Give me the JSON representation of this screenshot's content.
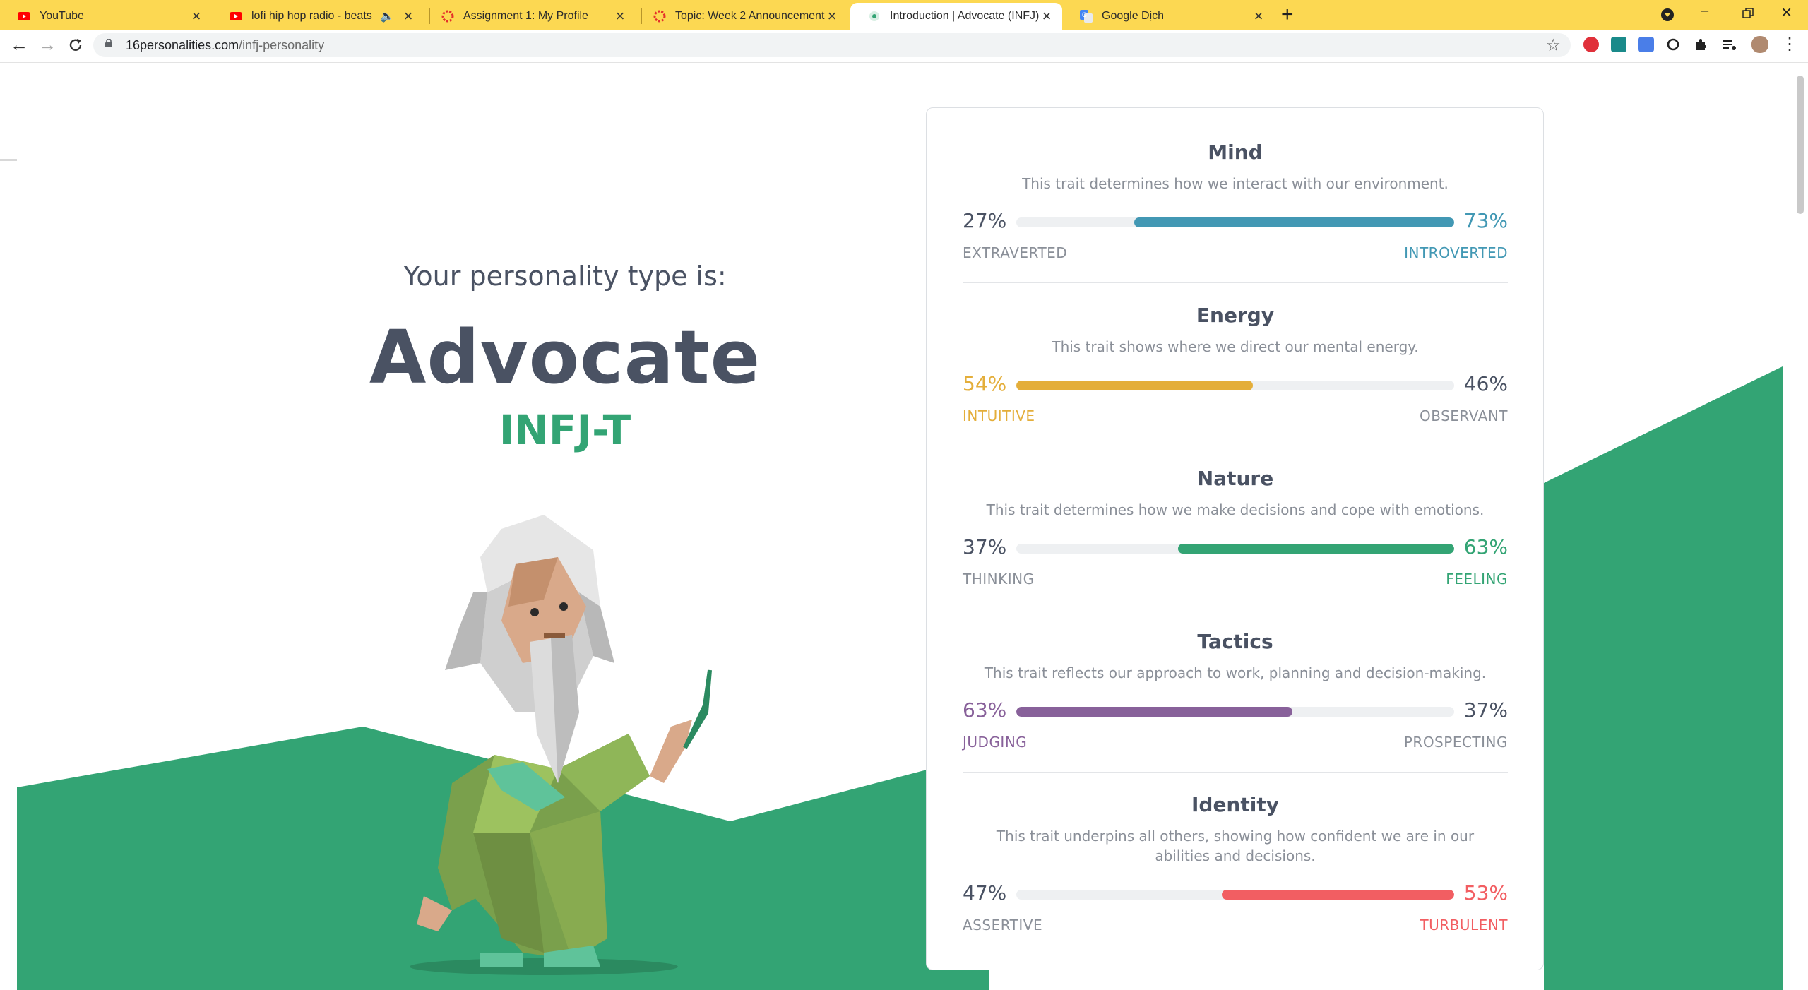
{
  "browser": {
    "tabs": [
      {
        "title": "YouTube",
        "active": false
      },
      {
        "title": "lofi hip hop radio - beats to r",
        "active": false
      },
      {
        "title": "Assignment 1: My Profile",
        "active": false
      },
      {
        "title": "Topic: Week 2 Announcement",
        "active": false
      },
      {
        "title": "Introduction | Advocate (INFJ) Pe",
        "active": true
      },
      {
        "title": "Google Dịch",
        "active": false
      }
    ],
    "url_host": "16personalities.com",
    "url_path": "/infj-personality"
  },
  "result": {
    "intro": "Your personality type is:",
    "type_name": "Advocate",
    "type_code": "INFJ-T"
  },
  "traits": [
    {
      "title": "Mind",
      "desc": "This trait determines how we interact with our environment.",
      "left_pct": "27%",
      "right_pct": "73%",
      "left_label": "EXTRAVERTED",
      "right_label": "INTROVERTED",
      "dominant": "right",
      "fill_fraction": 0.73,
      "color": "#4298b4"
    },
    {
      "title": "Energy",
      "desc": "This trait shows where we direct our mental energy.",
      "left_pct": "54%",
      "right_pct": "46%",
      "left_label": "INTUITIVE",
      "right_label": "OBSERVANT",
      "dominant": "left",
      "fill_fraction": 0.54,
      "color": "#e4ae3a"
    },
    {
      "title": "Nature",
      "desc": "This trait determines how we make decisions and cope with emotions.",
      "left_pct": "37%",
      "right_pct": "63%",
      "left_label": "THINKING",
      "right_label": "FEELING",
      "dominant": "right",
      "fill_fraction": 0.63,
      "color": "#33a474"
    },
    {
      "title": "Tactics",
      "desc": "This trait reflects our approach to work, planning and decision-making.",
      "left_pct": "63%",
      "right_pct": "37%",
      "left_label": "JUDGING",
      "right_label": "PROSPECTING",
      "dominant": "left",
      "fill_fraction": 0.63,
      "color": "#88619a"
    },
    {
      "title": "Identity",
      "desc": "This trait underpins all others, showing how confident we are in our abilities and decisions.",
      "left_pct": "47%",
      "right_pct": "53%",
      "left_label": "ASSERTIVE",
      "right_label": "TURBULENT",
      "dominant": "right",
      "fill_fraction": 0.53,
      "color": "#f25e62"
    }
  ],
  "colors": {
    "accent_green": "#33a474",
    "chrome_yellow": "#fcd852",
    "heading": "#4a5263"
  }
}
